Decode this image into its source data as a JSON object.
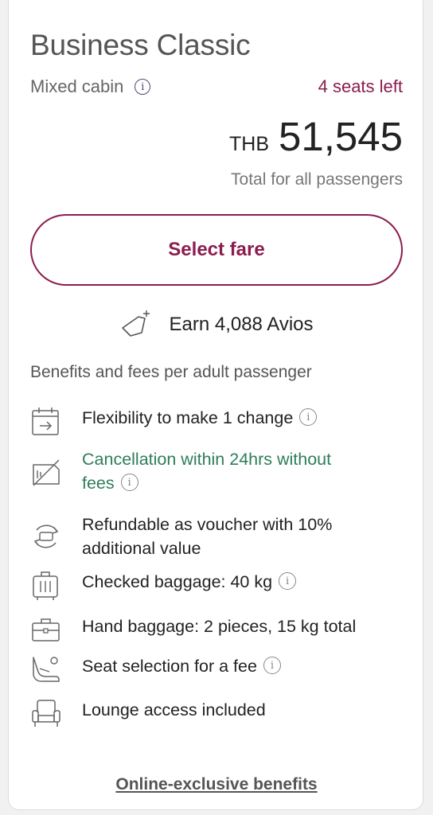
{
  "fare": {
    "title": "Business Classic",
    "cabin_label": "Mixed cabin",
    "seats_left": "4 seats left",
    "currency": "THB",
    "amount": "51,545",
    "total_note": "Total for all passengers",
    "select_label": "Select fare",
    "avios_label": "Earn 4,088 Avios"
  },
  "benefits": {
    "heading": "Benefits and fees per adult passenger",
    "items": [
      {
        "icon": "calendar-change-icon",
        "text": "Flexibility to make 1 change",
        "info": true
      },
      {
        "icon": "cancellation-icon",
        "text_line1": "Cancellation within 24hrs without",
        "text_line2": "fees",
        "info": true
      },
      {
        "icon": "refund-voucher-icon",
        "text_line1": "Refundable as voucher with 10%",
        "text_line2": "additional value",
        "info": false
      },
      {
        "icon": "checked-baggage-icon",
        "text": "Checked baggage: 40 kg",
        "info": true
      },
      {
        "icon": "hand-baggage-icon",
        "text": "Hand baggage: 2 pieces, 15 kg total",
        "info": false
      },
      {
        "icon": "seat-selection-icon",
        "text": "Seat selection for a fee",
        "info": true
      },
      {
        "icon": "lounge-icon",
        "text": "Lounge access included",
        "info": false
      }
    ]
  },
  "footer": {
    "online_link": "Online-exclusive benefits"
  },
  "colors": {
    "accent": "#8b1d4e",
    "green": "#2e7d5b"
  }
}
